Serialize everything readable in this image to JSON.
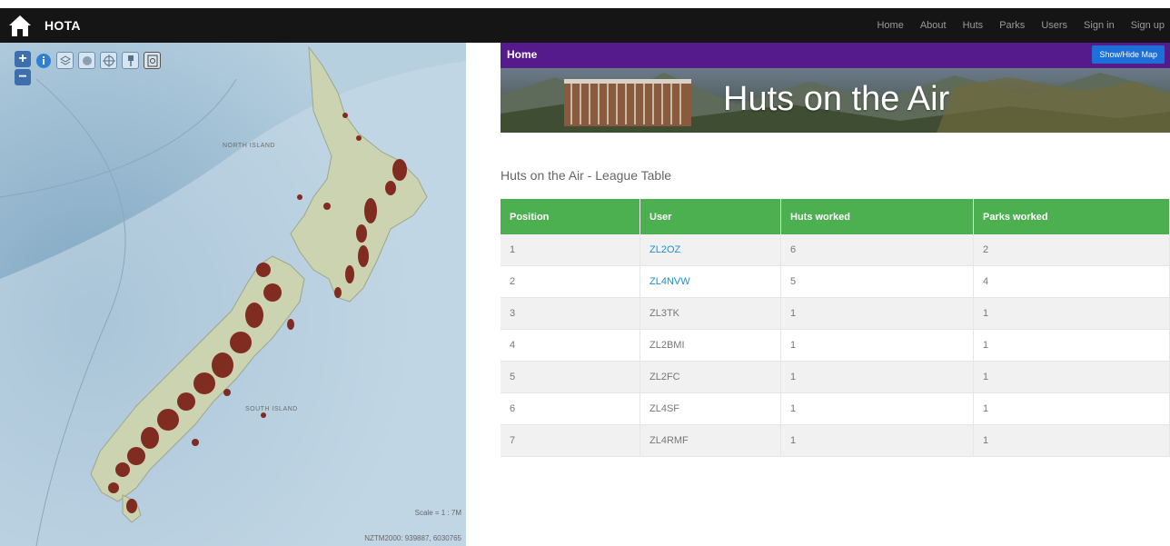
{
  "navbar": {
    "brand": "HOTA",
    "links": [
      "Home",
      "About",
      "Huts",
      "Parks",
      "Users",
      "Sign in",
      "Sign up"
    ]
  },
  "map": {
    "labels": {
      "north_island": "NORTH ISLAND",
      "south_island": "SOUTH ISLAND"
    },
    "scale": "Scale = 1 : 7M",
    "coords": "NZTM2000: 939887, 6030765",
    "tools": [
      "zoom-in",
      "zoom-out",
      "info",
      "layers",
      "basemap",
      "locate",
      "pin",
      "help"
    ]
  },
  "header": {
    "home_label": "Home",
    "show_hide": "Show/Hide Map",
    "banner_title": "Huts on the Air"
  },
  "league": {
    "title": "Huts on the Air - League Table",
    "columns": [
      "Position",
      "User",
      "Huts worked",
      "Parks worked"
    ],
    "rows": [
      {
        "position": "1",
        "user": "ZL2OZ",
        "huts": "6",
        "parks": "2",
        "link": true
      },
      {
        "position": "2",
        "user": "ZL4NVW",
        "huts": "5",
        "parks": "4",
        "link": true
      },
      {
        "position": "3",
        "user": "ZL3TK",
        "huts": "1",
        "parks": "1",
        "link": false
      },
      {
        "position": "4",
        "user": "ZL2BMI",
        "huts": "1",
        "parks": "1",
        "link": false
      },
      {
        "position": "5",
        "user": "ZL2FC",
        "huts": "1",
        "parks": "1",
        "link": false
      },
      {
        "position": "6",
        "user": "ZL4SF",
        "huts": "1",
        "parks": "1",
        "link": false
      },
      {
        "position": "7",
        "user": "ZL4RMF",
        "huts": "1",
        "parks": "1",
        "link": false
      }
    ]
  },
  "colors": {
    "header_purple": "#551a8b",
    "table_green": "#4caf50",
    "link_blue": "#1e8fd0",
    "button_blue": "#1f6fd8"
  }
}
